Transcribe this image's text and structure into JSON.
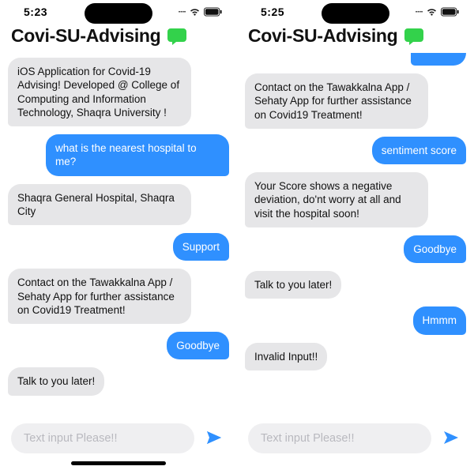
{
  "phones": [
    {
      "status": {
        "time": "5:23"
      },
      "header": {
        "title": "Covi-SU-Advising"
      },
      "messages": [
        {
          "role": "bot",
          "text": "iOS Application for Covid-19 Advising! Developed @ College of Computing and Information Technology, Shaqra University !"
        },
        {
          "role": "user",
          "text": "what is the nearest hospital to me?"
        },
        {
          "role": "bot",
          "text": "Shaqra General Hospital, Shaqra City"
        },
        {
          "role": "user",
          "text": "Support"
        },
        {
          "role": "bot",
          "text": "Contact on the Tawakkalna App / Sehaty App for further assistance on Covid19 Treatment!"
        },
        {
          "role": "user",
          "text": "Goodbye"
        },
        {
          "role": "bot",
          "text": "Talk to you later!"
        }
      ],
      "input": {
        "placeholder": "Text input Please!!"
      },
      "show_home_indicator": true
    },
    {
      "status": {
        "time": "5:25"
      },
      "header": {
        "title": "Covi-SU-Advising"
      },
      "partial_top_user": "",
      "messages": [
        {
          "role": "bot",
          "text": "Contact on the Tawakkalna App / Sehaty App for further assistance on Covid19 Treatment!"
        },
        {
          "role": "user",
          "text": "sentiment score"
        },
        {
          "role": "bot",
          "text": "Your Score shows a negative deviation, do'nt worry at all and visit the hospital soon!"
        },
        {
          "role": "user",
          "text": "Goodbye"
        },
        {
          "role": "bot",
          "text": "Talk to you later!"
        },
        {
          "role": "user",
          "text": "Hmmm"
        },
        {
          "role": "bot",
          "text": "Invalid Input!!"
        }
      ],
      "input": {
        "placeholder": "Text input Please!!"
      },
      "show_home_indicator": false
    }
  ],
  "icons": {
    "chat_bubble": "chat-bubble-icon",
    "send": "send-icon",
    "wifi": "wifi-icon",
    "battery": "battery-icon",
    "signal": "signal-icon"
  },
  "colors": {
    "user_bubble": "#2f90ff",
    "bot_bubble": "#e6e6e8",
    "chat_icon": "#33d24b",
    "send_icon": "#2f90ff"
  }
}
